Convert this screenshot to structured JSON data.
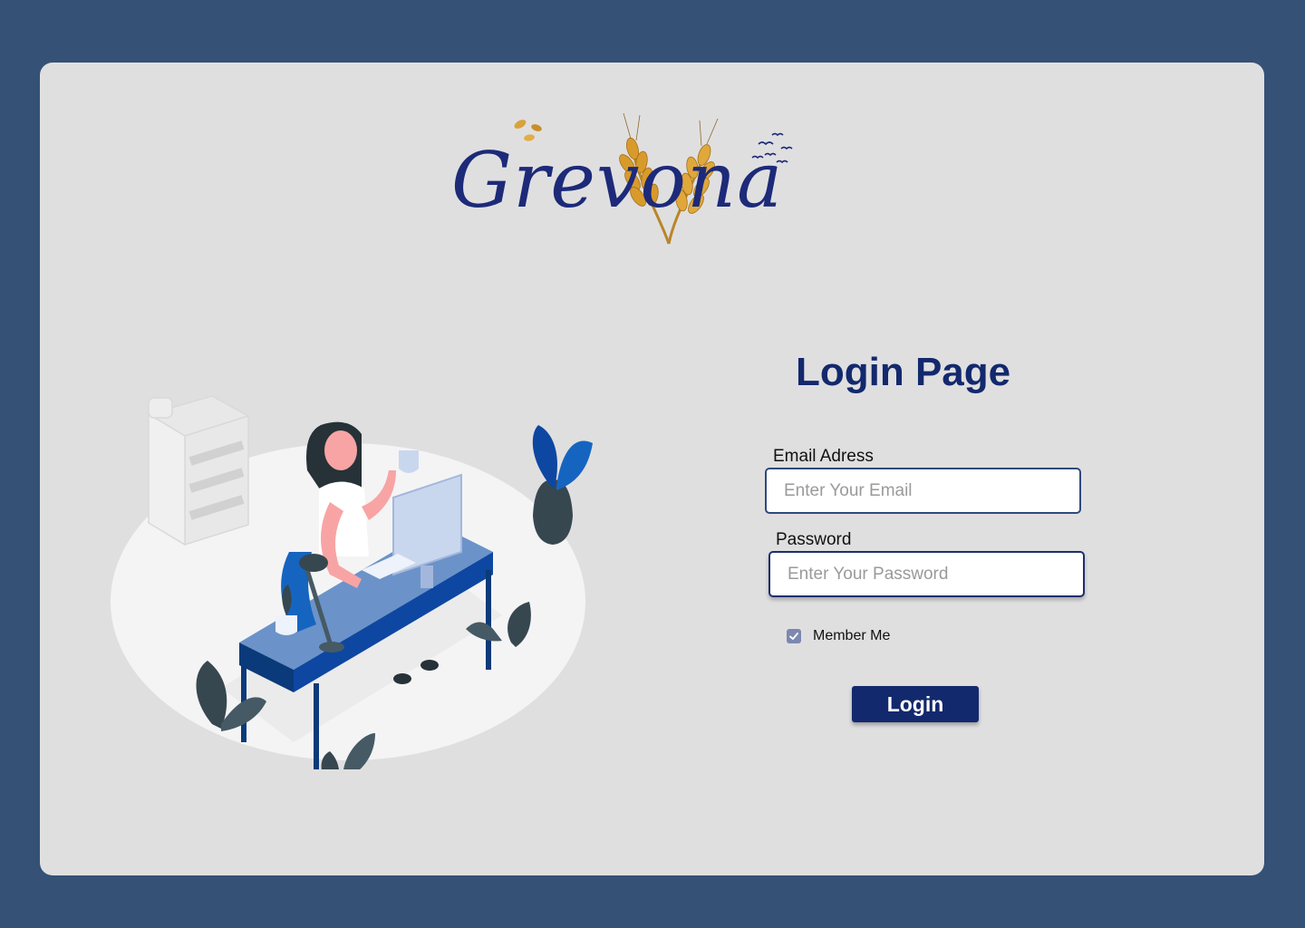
{
  "brand": {
    "logo_text": "Grevona",
    "colors": {
      "primary": "#13296d",
      "background": "#355176",
      "card": "#e0dfe0",
      "wheat": "#d39a2a"
    },
    "logo_icon": "wheat-ears-icon"
  },
  "illustration": {
    "icon": "woman-at-desk-illustration"
  },
  "login": {
    "title": "Login Page",
    "email_label": "Email Adress",
    "email_placeholder": "Enter Your Email",
    "email_value": "",
    "password_label": "Password",
    "password_placeholder": "Enter Your Password",
    "password_value": "",
    "remember_label": "Member Me",
    "remember_checked": true,
    "button_label": "Login"
  }
}
